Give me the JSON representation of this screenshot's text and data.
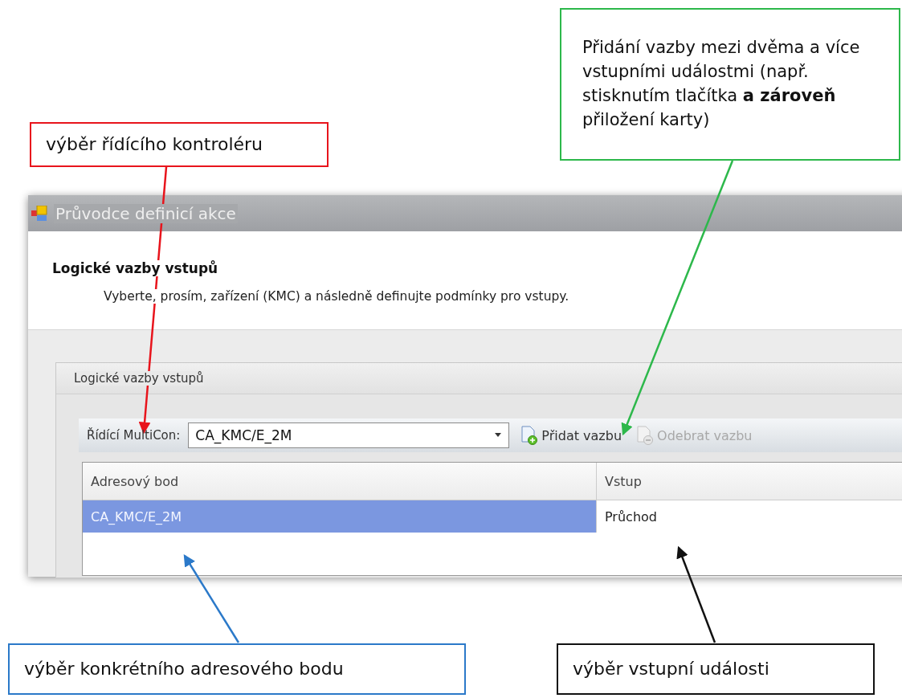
{
  "window": {
    "title": "Průvodce definicí akce"
  },
  "header": {
    "title": "Logické vazby vstupů",
    "subtitle": "Vyberte, prosím, zařízení (KMC) a následně definujte podmínky pro vstupy."
  },
  "group": {
    "title": "Logické vazby vstupů"
  },
  "toolbar": {
    "controller_label": "Řídící MultiCon:",
    "controller_value": "CA_KMC/E_2M",
    "buttons": [
      {
        "kind": "add",
        "label": "Přidat vazbu",
        "disabled": false
      },
      {
        "kind": "remove",
        "label": "Odebrat vazbu",
        "disabled": true
      }
    ]
  },
  "table": {
    "columns": [
      "Adresový bod",
      "Vstup"
    ],
    "rows": [
      {
        "cells": [
          {
            "text": "CA_KMC/E_2M",
            "selected": true
          },
          {
            "text": "Průchod",
            "selected": false
          }
        ]
      }
    ]
  },
  "callouts": [
    {
      "text": "výběr řídícího kontroléru",
      "color": "#e8141c"
    },
    {
      "text": "Přidání vazby mezi dvěma a více vstupními událostmi (např. stisknutím tlačítka **a zároveň** přiložení karty)",
      "color": "#2db84b"
    },
    {
      "text": "výběr konkrétního adresového bodu",
      "color": "#2b79c9"
    },
    {
      "text": "výběr vstupní události",
      "color": "#111111"
    }
  ]
}
